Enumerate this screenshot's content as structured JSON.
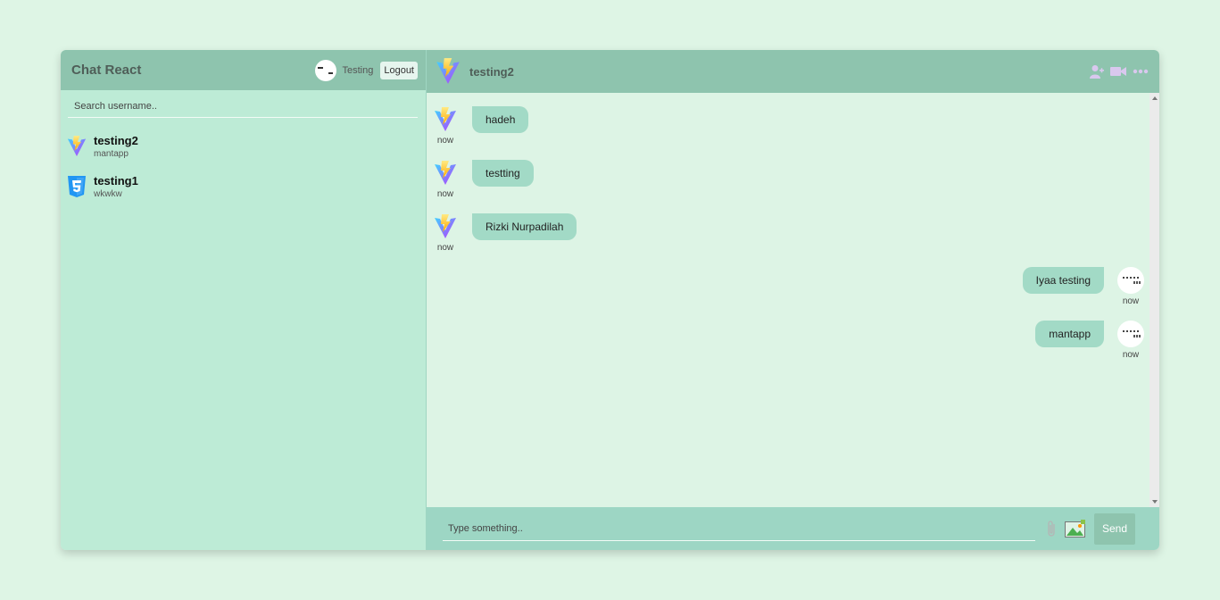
{
  "sidebar": {
    "app_title": "Chat React",
    "current_user": "Testing",
    "logout_label": "Logout",
    "search_placeholder": "Search username..",
    "chats": [
      {
        "name": "testing2",
        "last_message": "mantapp",
        "icon": "vite-logo-icon"
      },
      {
        "name": "testing1",
        "last_message": "wkwkw",
        "icon": "css3-logo-icon"
      }
    ]
  },
  "chat": {
    "contact_name": "testing2",
    "header_icons": [
      "add-user-icon",
      "video-camera-icon",
      "more-options-icon"
    ],
    "messages": [
      {
        "text": "hadeh",
        "time": "now",
        "owner": false
      },
      {
        "text": "testting",
        "time": "now",
        "owner": false
      },
      {
        "text": "Rizki Nurpadilah",
        "time": "now",
        "owner": false
      },
      {
        "text": "Iyaa testing",
        "time": "now",
        "owner": true
      },
      {
        "text": "mantapp",
        "time": "now",
        "owner": true
      }
    ],
    "input_placeholder": "Type something..",
    "send_label": "Send"
  },
  "colors": {
    "page_background": "#def5e5",
    "header": "#8ec4ae",
    "sidebar": "#bdebd6",
    "bubble": "#a2dac6",
    "input_bar": "#9dd6c4"
  }
}
